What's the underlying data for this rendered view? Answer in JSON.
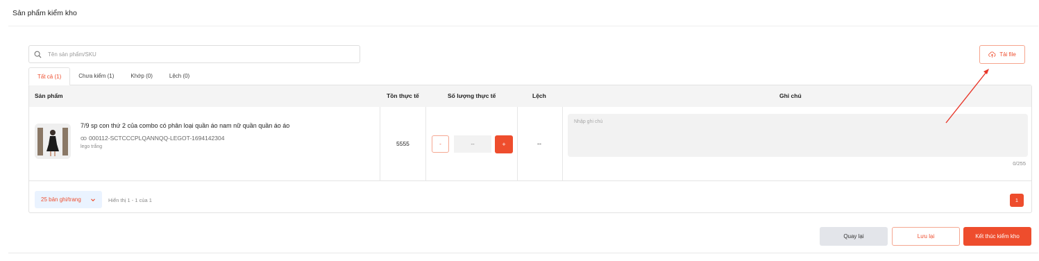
{
  "page": {
    "title": "Sản phẩm kiểm kho"
  },
  "search": {
    "placeholder": "Tên sản phẩm/SKU",
    "value": ""
  },
  "toolbar": {
    "upload_label": "Tải file"
  },
  "tabs": [
    {
      "label": "Tất cả (1)",
      "active": true
    },
    {
      "label": "Chưa kiểm (1)",
      "active": false
    },
    {
      "label": "Khớp (0)",
      "active": false
    },
    {
      "label": "Lệch (0)",
      "active": false
    }
  ],
  "table": {
    "headers": {
      "product": "Sản phẩm",
      "stock": "Tồn thực tế",
      "actual_qty": "Số lượng thực tế",
      "diff": "Lệch",
      "note": "Ghi chú"
    },
    "rows": [
      {
        "name": "7/9 sp con thứ 2 của combo có phân loại quần áo nam nữ quần quần áo áo",
        "sku": "000112-SCTCCCPLQANNQQ-LEGOT-1694142304",
        "variant": "lego trắng",
        "stock": "5555",
        "qty_minus": "-",
        "qty_placeholder": "--",
        "qty_plus": "+",
        "diff": "--",
        "note_placeholder": "Nhập ghi chú",
        "note_count": "0/255"
      }
    ]
  },
  "pagination": {
    "page_size_label": "25 bản ghi/trang",
    "info": "Hiển thị 1 - 1 của 1",
    "current_page": "1"
  },
  "actions": {
    "back_label": "Quay lại",
    "save_label": "Lưu lại",
    "finish_label": "Kết thúc kiểm kho"
  },
  "colors": {
    "accent": "#ee4d2d",
    "annotation_arrow": "#e8372a",
    "header_bg": "#f4f4f4",
    "input_bg": "#f2f2f2",
    "page_size_bg": "#eaf3ff"
  },
  "icons": {
    "search": "search-icon",
    "upload": "cloud-upload-icon",
    "sku": "link-icon",
    "page_size": "chevron-down-icon"
  }
}
